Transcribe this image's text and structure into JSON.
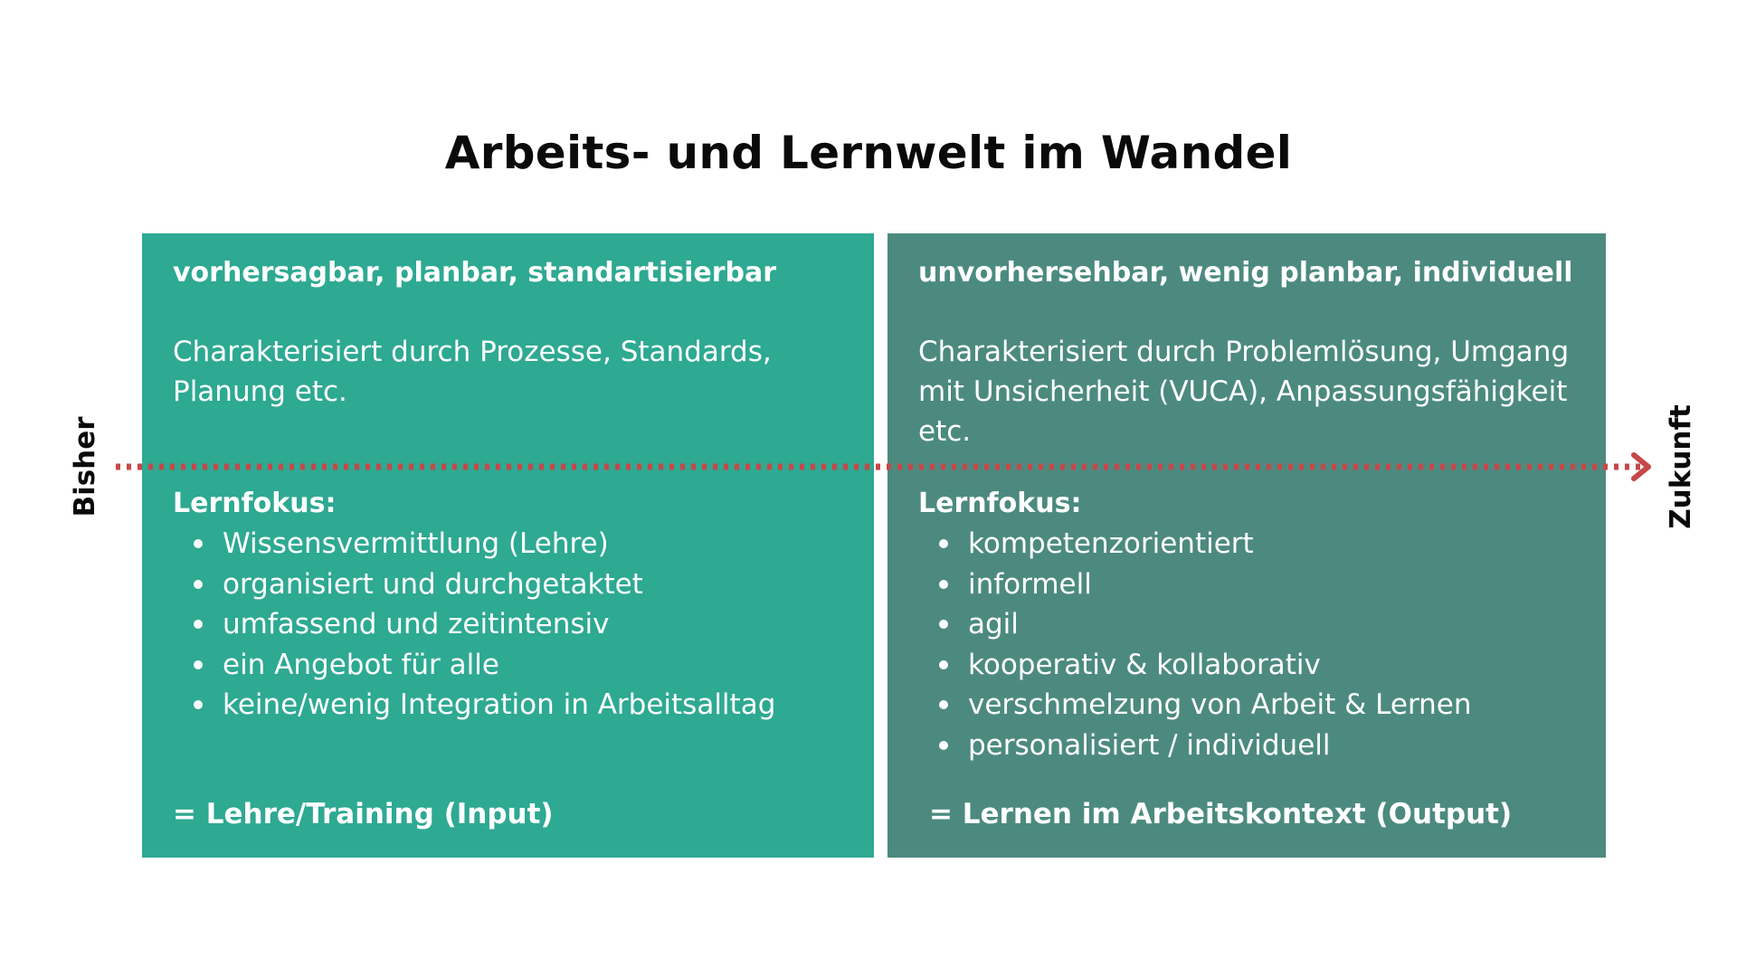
{
  "title": "Arbeits- und Lernwelt im Wandel",
  "colors": {
    "left_panel": "#2ea992",
    "right_panel": "#4c8a80",
    "arrow": "#c64848"
  },
  "axis": {
    "left_label": "Bisher",
    "right_label": "Zukunft"
  },
  "left": {
    "heading": "vorhersagbar, planbar, standartisierbar",
    "description": "Charakterisiert durch Prozesse, Standards, Planung etc.",
    "focus_heading": "Lernfokus:",
    "focus_items": [
      "Wissensvermittlung (Lehre)",
      "organisiert und durchgetaktet",
      "umfassend und zeitintensiv",
      "ein Angebot für alle",
      "keine/wenig Integration in Arbeitsalltag"
    ],
    "summary": "= Lehre/Training (Input)"
  },
  "right": {
    "heading": "unvorhersehbar, wenig planbar, individuell",
    "description": "Charakterisiert durch Problemlösung, Umgang mit Unsicherheit (VUCA), Anpassungsfähigkeit etc.",
    "focus_heading": "Lernfokus:",
    "focus_items": [
      "kompetenzorientiert",
      "informell",
      "agil",
      "kooperativ & kollaborativ",
      "verschmelzung von Arbeit & Lernen",
      "personalisiert / individuell"
    ],
    "summary": "= Lernen im Arbeitskontext (Output)"
  }
}
